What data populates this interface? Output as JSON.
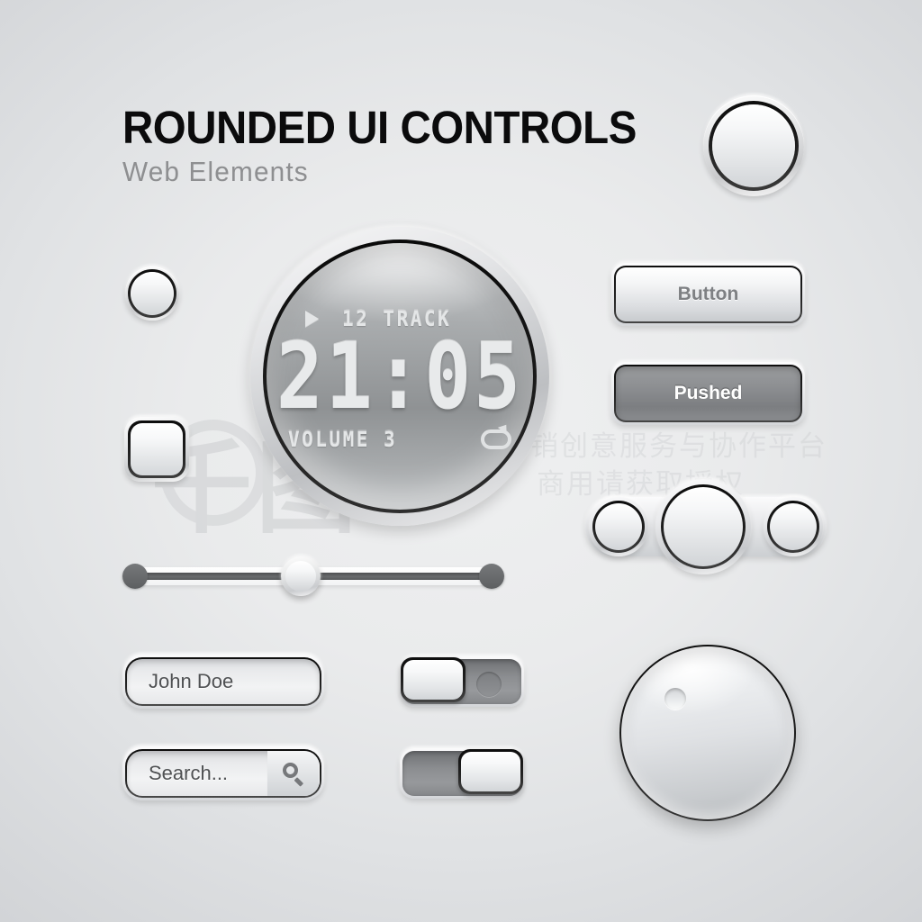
{
  "header": {
    "title": "ROUNDED UI CONTROLS",
    "subtitle": "Web Elements"
  },
  "lcd": {
    "play_icon": "play-icon",
    "track_label": "12 TRACK",
    "time": "21:05",
    "volume_label": "VOLUME 3",
    "repeat_icon": "repeat-icon"
  },
  "buttons": {
    "normal_label": "Button",
    "pushed_label": "Pushed"
  },
  "fields": {
    "name_value": "John Doe",
    "search_value": "Search...",
    "search_icon": "search-icon"
  },
  "cluster": {
    "left_label": "cluster-button-left",
    "center_label": "cluster-button-center",
    "right_label": "cluster-button-right"
  },
  "slider": {
    "value_percent": 46
  },
  "toggles": {
    "off_state": "off",
    "on_state": "on"
  },
  "knob": {
    "indicator": "knob-indicator"
  },
  "watermark": {
    "logo": "千图",
    "line1": "营销创意服务与协作平台",
    "line2": "商用请获取授权"
  },
  "colors": {
    "background_light": "#eff0f1",
    "background_edge": "#d2d4d7",
    "title": "#0b0b0c",
    "subtitle": "#8e8f91",
    "button_text": "#7e8083",
    "pushed_text": "#ffffff",
    "lcd_text": "#e6e8e9",
    "field_text": "#4f5153"
  }
}
